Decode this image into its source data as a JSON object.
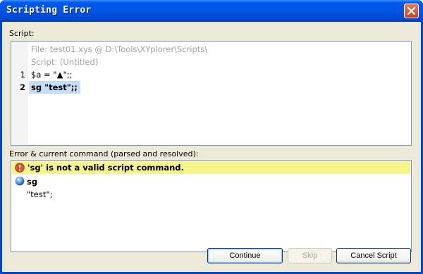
{
  "window": {
    "title": "Scripting Error"
  },
  "script": {
    "label": "Script:",
    "header_file": "File: test01.xys @ D:\\Tools\\XYplorer\\Scripts\\",
    "header_script": "Script: (Untitled)",
    "lines": [
      {
        "number": "1",
        "code": "$a = \"▲\";;"
      },
      {
        "number": "2",
        "code": "sg \"test\";;"
      }
    ]
  },
  "error": {
    "label": "Error & current command (parsed and resolved):",
    "message": "'sg' is not a valid script command.",
    "command": "sg",
    "argument": "\"test\";"
  },
  "buttons": {
    "continue": "Continue",
    "skip": "Skip",
    "cancel": "Cancel Script"
  },
  "colors": {
    "error_highlight": "#f5f58c",
    "selection": "#c6ddf7",
    "dialog_bg": "#ece9d8"
  }
}
